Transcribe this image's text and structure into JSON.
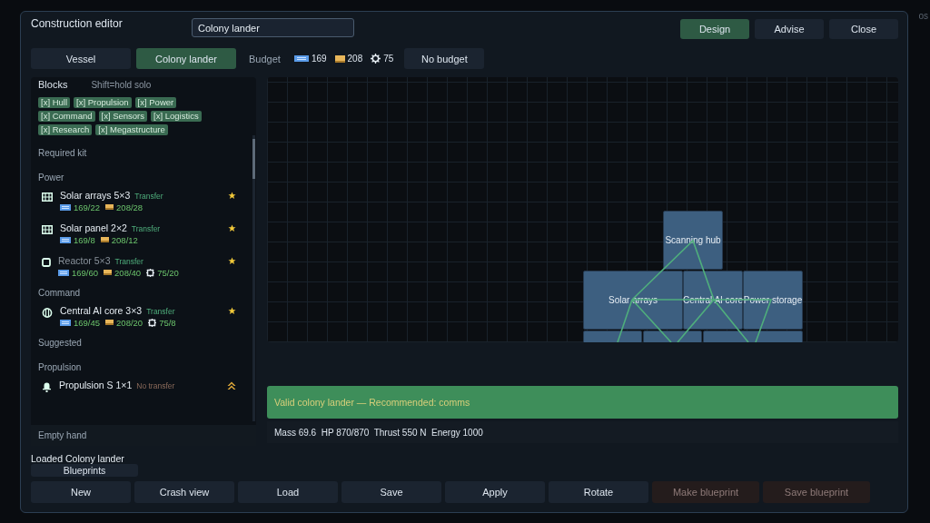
{
  "backdrop_text": "os",
  "window": {
    "title": "Construction editor",
    "name_field": {
      "value": "Colony lander"
    },
    "modes": [
      {
        "label": "Design",
        "selected": true
      },
      {
        "label": "Advise",
        "selected": false
      },
      {
        "label": "Close",
        "selected": false
      }
    ]
  },
  "targets": [
    {
      "label": "Vessel",
      "selected": false
    },
    {
      "label": "Colony lander",
      "selected": true
    }
  ],
  "budget": {
    "label": "Budget",
    "resources": [
      {
        "kind": "energy",
        "value": "169"
      },
      {
        "kind": "metal",
        "value": "208"
      },
      {
        "kind": "chip",
        "value": "75"
      }
    ],
    "button": "No budget"
  },
  "blocks_panel": {
    "title": "Blocks",
    "hint": "Shift=hold solo",
    "filters": [
      "[x] Hull",
      "[x] Propulsion",
      "[x] Power",
      "[x] Command",
      "[x] Sensors",
      "[x] Logistics",
      "[x] Research",
      "[x] Megastructure"
    ],
    "sections": [
      {
        "kind": "group",
        "label": "Required kit"
      },
      {
        "kind": "category",
        "label": "Power"
      },
      {
        "kind": "item",
        "name": "Solar arrays 5×3",
        "transfer": "Transfer",
        "transferable": true,
        "disabled": false,
        "costs": [
          {
            "kind": "energy",
            "value": "169/22"
          },
          {
            "kind": "metal",
            "value": "208/28"
          }
        ]
      },
      {
        "kind": "item",
        "name": "Solar panel 2×2",
        "transfer": "Transfer",
        "transferable": true,
        "disabled": false,
        "costs": [
          {
            "kind": "energy",
            "value": "169/8"
          },
          {
            "kind": "metal",
            "value": "208/12"
          }
        ]
      },
      {
        "kind": "item",
        "name": "Reactor 5×3",
        "transfer": "Transfer",
        "transferable": true,
        "disabled": true,
        "costs": [
          {
            "kind": "energy",
            "value": "169/60"
          },
          {
            "kind": "metal",
            "value": "208/40"
          },
          {
            "kind": "chip",
            "value": "75/20"
          }
        ]
      },
      {
        "kind": "category",
        "label": "Command"
      },
      {
        "kind": "item",
        "name": "Central AI core 3×3",
        "transfer": "Transfer",
        "transferable": true,
        "disabled": false,
        "costs": [
          {
            "kind": "energy",
            "value": "169/45"
          },
          {
            "kind": "metal",
            "value": "208/20"
          },
          {
            "kind": "chip",
            "value": "75/8"
          }
        ]
      },
      {
        "kind": "group",
        "label": "Suggested"
      },
      {
        "kind": "category",
        "label": "Propulsion"
      },
      {
        "kind": "item",
        "name": "Propulsion S 1×1",
        "transfer": "No transfer",
        "transferable": false,
        "disabled": false
      }
    ],
    "hand": "Empty hand"
  },
  "canvas": {
    "blocks": [
      {
        "label": "Scanning hub"
      },
      {
        "label": "Solar arrays"
      },
      {
        "label": "Central AI core"
      },
      {
        "label": "Power storage"
      }
    ]
  },
  "validation": {
    "message": "Valid colony lander — Recommended: comms",
    "valid": true
  },
  "stats": "Mass 69.6  HP 870/870  Thrust 550 N  Energy 1000",
  "loaded": "Loaded Colony lander",
  "blueprints_button": "Blueprints",
  "actions": [
    {
      "label": "New",
      "disabled": false
    },
    {
      "label": "Crash view",
      "disabled": false
    },
    {
      "label": "Load",
      "disabled": false
    },
    {
      "label": "Save",
      "disabled": false
    },
    {
      "label": "Apply",
      "disabled": false
    },
    {
      "label": "Rotate",
      "disabled": false
    },
    {
      "label": "Make blueprint",
      "disabled": true
    },
    {
      "label": "Save blueprint",
      "disabled": true
    }
  ]
}
